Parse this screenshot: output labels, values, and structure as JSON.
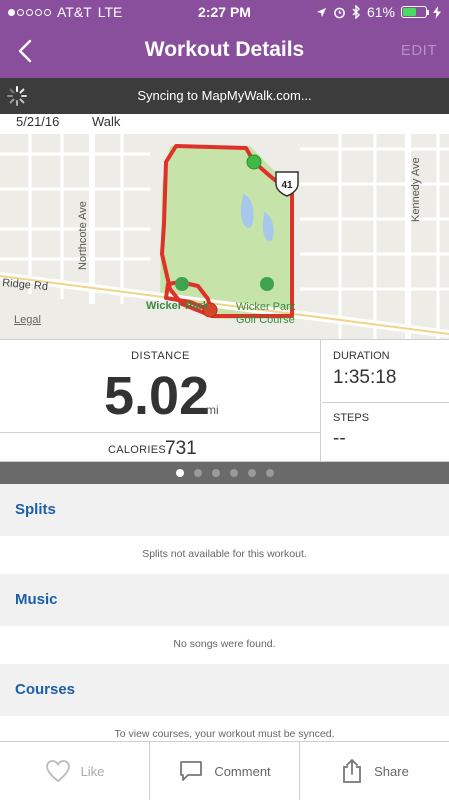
{
  "status": {
    "carrier": "AT&T",
    "network": "LTE",
    "time": "2:27 PM",
    "battery": "61%",
    "battery_level": 0.61
  },
  "nav": {
    "title": "Workout Details",
    "edit_label": "EDIT"
  },
  "sync": {
    "message": "Syncing to MapMyWalk.com..."
  },
  "workout": {
    "date": "5/21/16",
    "activity": "Walk"
  },
  "map": {
    "labels": {
      "street_left": "Northcote Ave",
      "street_right": "Kennedy Ave",
      "road": "Ridge Rd",
      "highway": "41",
      "park": "Wicker Park",
      "golf": "Wicker Park Golf Course",
      "legal": "Legal"
    },
    "colors": {
      "route": "#e0302a",
      "start": "#3fb844",
      "end": "#d9452b",
      "park": "#c6e3a9"
    }
  },
  "stats": {
    "distance_label": "DISTANCE",
    "distance_value": "5.02",
    "distance_unit": "mi",
    "calories_label": "CALORIES",
    "calories_value": "731",
    "duration_label": "DURATION",
    "duration_value": "1:35:18",
    "steps_label": "STEPS",
    "steps_value": "--"
  },
  "pager": {
    "pages": 6,
    "active_index": 0
  },
  "sections": {
    "splits": {
      "title": "Splits",
      "message": "Splits not available for this workout."
    },
    "music": {
      "title": "Music",
      "message": "No songs were found."
    },
    "courses": {
      "title": "Courses",
      "message": "To view courses, your workout must be synced."
    }
  },
  "actions": {
    "like": "Like",
    "comment": "Comment",
    "share": "Share"
  },
  "colors": {
    "header_purple": "#8a4f9c",
    "section_link_blue": "#1d5fa8",
    "sync_bar": "#3c3c3c"
  }
}
